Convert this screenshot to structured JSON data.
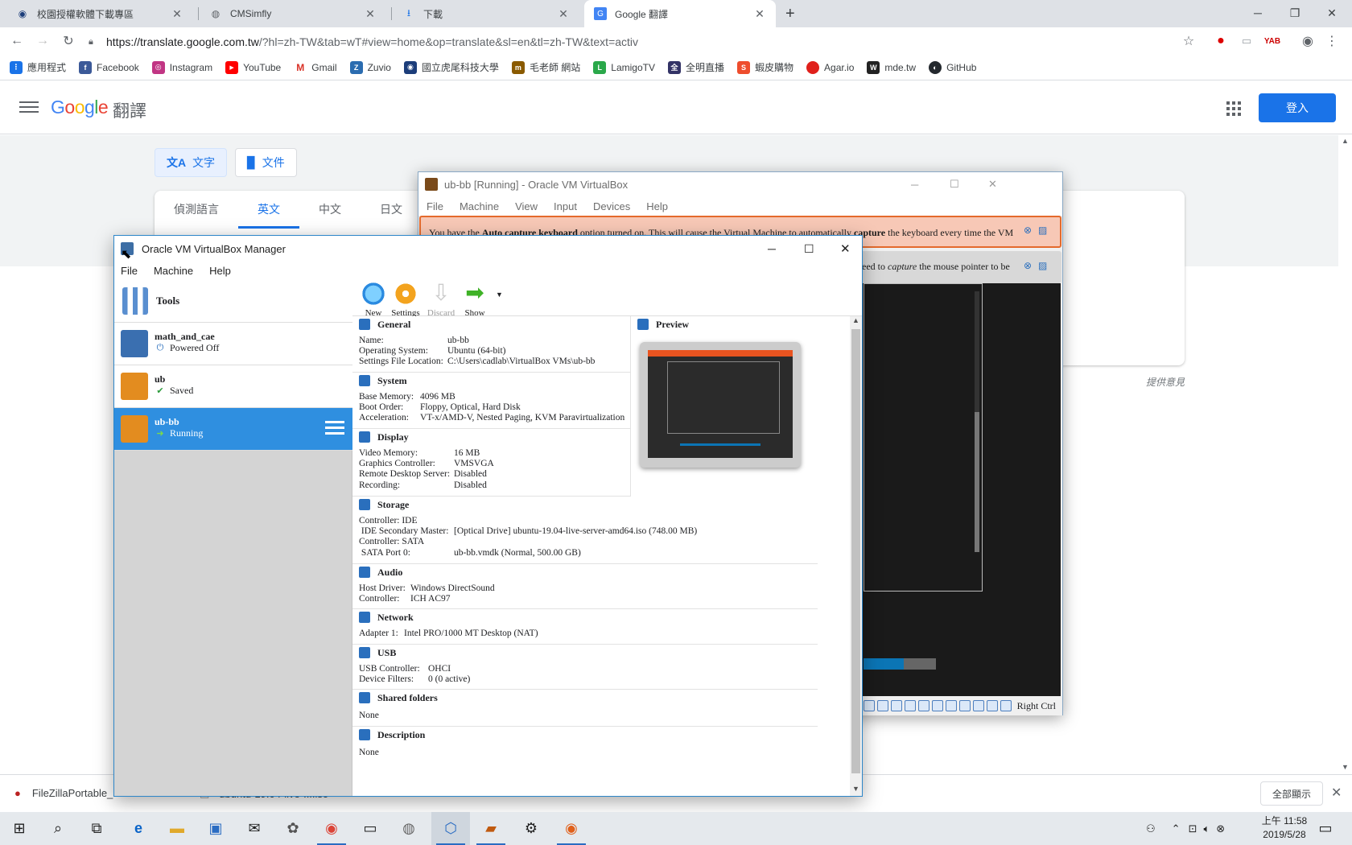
{
  "browser": {
    "tabs": [
      {
        "title": "校園授權軟體下載專區",
        "active": false
      },
      {
        "title": "CMSimfly",
        "active": false
      },
      {
        "title": "下載",
        "active": false
      },
      {
        "title": "Google 翻譯",
        "active": true
      }
    ],
    "new_tab": "+",
    "url": {
      "host": "https://translate.google.com.tw",
      "path": "/?hl=zh-TW&tab=wT#view=home&op=translate&sl=en&tl=zh-TW&text=activ"
    },
    "bookmarks": [
      {
        "label": "應用程式",
        "color": "#1a73e8",
        "glyph": "⋮"
      },
      {
        "label": "Facebook",
        "color": "#3b5998",
        "glyph": "f"
      },
      {
        "label": "Instagram",
        "color": "#c13584",
        "glyph": "◎"
      },
      {
        "label": "YouTube",
        "color": "#ff0000",
        "glyph": "▶"
      },
      {
        "label": "Gmail",
        "color": "#d93025",
        "glyph": "M"
      },
      {
        "label": "Zuvio",
        "color": "#2b6cb0",
        "glyph": "Z"
      },
      {
        "label": "國立虎尾科技大學",
        "color": "#1c3d7a",
        "glyph": "◉"
      },
      {
        "label": "毛老師 網站",
        "color": "#8a5a00",
        "glyph": "m"
      },
      {
        "label": "LamigoTV",
        "color": "#2aa84a",
        "glyph": "L"
      },
      {
        "label": "全明直播",
        "color": "#333366",
        "glyph": "全"
      },
      {
        "label": "蝦皮購物",
        "color": "#ee4d2d",
        "glyph": "S"
      },
      {
        "label": "Agar.io",
        "color": "#e0201b",
        "glyph": "●"
      },
      {
        "label": "mde.tw",
        "color": "#222222",
        "glyph": "W"
      },
      {
        "label": "GitHub",
        "color": "#24292e",
        "glyph": "◐"
      }
    ]
  },
  "translate": {
    "logo": "Google",
    "product": "翻譯",
    "signin": "登入",
    "mode_text": "文字",
    "mode_doc": "文件",
    "lang_tabs": [
      "偵測語言",
      "英文",
      "中文",
      "日文"
    ],
    "selected_lang": "英文",
    "feedback": "提供意見"
  },
  "downloads": {
    "item1": "FileZillaPortable_...exe",
    "item2": "ubuntu-19.04-live-....iso",
    "show_all": "全部顯示"
  },
  "taskbar": {
    "time": "上午 11:58",
    "date": "2019/5/28"
  },
  "vm_window": {
    "title": "ub-bb [Running] - Oracle VM VirtualBox",
    "menu": [
      "File",
      "Machine",
      "View",
      "Input",
      "Devices",
      "Help"
    ],
    "notice1_pre": "You have the ",
    "notice1_bold": "Auto capture keyboard",
    "notice1_mid": " option turned on. This will cause the Virtual Machine to automatically ",
    "notice1_bold2": "capture",
    "notice1_post": " the keyboard every time the VM",
    "notice2_pre": "eed to ",
    "notice2_italic": "capture",
    "notice2_post": " the mouse pointer to be",
    "host_key": "Right Ctrl"
  },
  "manager": {
    "title": "Oracle VM VirtualBox Manager",
    "menu": [
      "File",
      "Machine",
      "Help"
    ],
    "tools_label": "Tools",
    "vms": [
      {
        "name": "math_and_cae",
        "state": "Powered Off",
        "selected": false
      },
      {
        "name": "ub",
        "state": "Saved",
        "selected": false
      },
      {
        "name": "ub-bb",
        "state": "Running",
        "selected": true
      }
    ],
    "toolbar": {
      "new": "New",
      "settings": "Settings",
      "discard": "Discard",
      "show": "Show"
    },
    "general": {
      "header": "General",
      "name_k": "Name:",
      "name_v": "ub-bb",
      "os_k": "Operating System:",
      "os_v": "Ubuntu (64-bit)",
      "loc_k": "Settings File Location:",
      "loc_v": "C:\\Users\\cadlab\\VirtualBox VMs\\ub-bb"
    },
    "preview": {
      "header": "Preview"
    },
    "system": {
      "header": "System",
      "mem_k": "Base Memory:",
      "mem_v": "4096 MB",
      "boot_k": "Boot Order:",
      "boot_v": "Floppy, Optical, Hard Disk",
      "acc_k": "Acceleration:",
      "acc_v": "VT-x/AMD-V, Nested Paging, KVM Paravirtualization"
    },
    "display": {
      "header": "Display",
      "vmem_k": "Video Memory:",
      "vmem_v": "16 MB",
      "gc_k": "Graphics Controller:",
      "gc_v": "VMSVGA",
      "rds_k": "Remote Desktop Server:",
      "rds_v": "Disabled",
      "rec_k": "Recording:",
      "rec_v": "Disabled"
    },
    "storage": {
      "header": "Storage",
      "c1": "Controller: IDE",
      "ide_k": " IDE Secondary Master:",
      "ide_v": "[Optical Drive] ubuntu-19.04-live-server-amd64.iso (748.00 MB)",
      "c2": "Controller: SATA",
      "sata_k": " SATA Port 0:",
      "sata_v": "ub-bb.vmdk (Normal, 500.00 GB)"
    },
    "audio": {
      "header": "Audio",
      "hd_k": "Host Driver:",
      "hd_v": "Windows DirectSound",
      "ctl_k": "Controller:",
      "ctl_v": "ICH AC97"
    },
    "network": {
      "header": "Network",
      "a_k": "Adapter 1:",
      "a_v": "Intel PRO/1000 MT Desktop (NAT)"
    },
    "usb": {
      "header": "USB",
      "uc_k": "USB Controller:",
      "uc_v": "OHCI",
      "df_k": "Device Filters:",
      "df_v": "0 (0 active)"
    },
    "shared": {
      "header": "Shared folders",
      "value": "None"
    },
    "description": {
      "header": "Description",
      "value": "None"
    }
  }
}
